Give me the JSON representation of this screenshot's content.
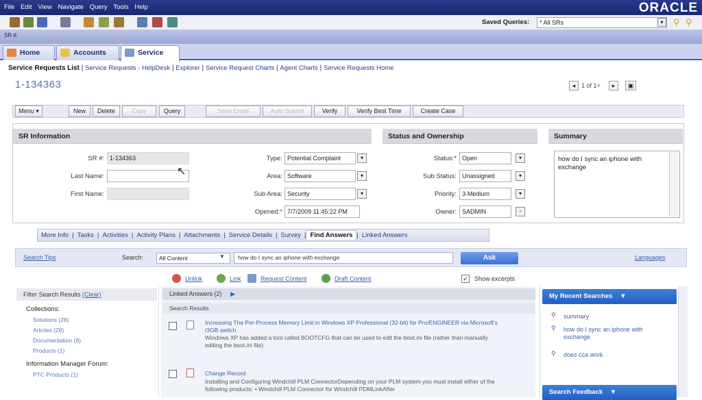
{
  "menubar": {
    "items": [
      "File",
      "Edit",
      "View",
      "Navigate",
      "Query",
      "Tools",
      "Help"
    ],
    "brand": "ORACLE"
  },
  "toolbar": {
    "saved_queries_label": "Saved Queries:",
    "saved_queries_value": "* All SRs"
  },
  "srbar": {
    "label": "SR #:"
  },
  "tabs": [
    "Home",
    "Accounts",
    "Service"
  ],
  "subnav": {
    "active": "Service Requests List",
    "items": [
      "Service Requests - HelpDesk",
      "Explorer",
      "Service Request Charts",
      "Agent Charts",
      "Service Requests Home"
    ]
  },
  "record": {
    "id": "1-134363",
    "pager": "1 of 1+"
  },
  "buttons": {
    "menu": "Menu ▾",
    "new": "New",
    "delete": "Delete",
    "copy": "Copy",
    "query": "Query",
    "send_correspondence": "Send Email",
    "auto_submit": "Auto Submit",
    "verify": "Verify",
    "verify_best_time": "Verify Best Time",
    "create_case": "Create Case"
  },
  "sr_info": {
    "header": "SR Information",
    "sr_label": "SR #:",
    "sr_value": "1-134363",
    "last_name_label": "Last Name:",
    "first_name_label": "First Name:",
    "type_label": "Type:",
    "type_value": "Potential Complaint",
    "area_label": "Area:",
    "area_value": "Software",
    "sub_area_label": "Sub Area:",
    "sub_area_value": "Security",
    "opened_label": "Opened:",
    "opened_value": "7/7/2009 11:45:22 PM"
  },
  "status": {
    "header": "Status and Ownership",
    "status_label": "Status:",
    "status_value": "Open",
    "sub_status_label": "Sub Status:",
    "sub_status_value": "Unassigned",
    "priority_label": "Priority:",
    "priority_value": "3-Medium",
    "owner_label": "Owner:",
    "owner_value": "SADMIN"
  },
  "summary": {
    "header": "Summary",
    "text": "how do I sync an iphone with exchange"
  },
  "view_tabs": {
    "items": [
      "More Info",
      "Tasks",
      "Activities",
      "Activity Plans",
      "Attachments",
      "Service Details",
      "Survey"
    ],
    "active": "Find Answers",
    "after": "Linked Answers"
  },
  "find_answers": {
    "search_tips": "Search Tips",
    "search_label": "Search:",
    "content_select": "All Content",
    "query": "how do I sync an iphone with exchange",
    "ask": "Ask",
    "languages": "Languages",
    "actions": [
      "Unlink",
      "Link",
      "Request Content",
      "Draft Content"
    ],
    "show_excerpts": "Show excerpts"
  },
  "filter": {
    "header": "Filter Search Results",
    "clear": "(Clear)",
    "collections_label": "Collections:",
    "collections": [
      "Solutions (28)",
      "Articles (28)",
      "Documentation (8)",
      "Products (1)"
    ],
    "forum_label": "Information Manager Forum:",
    "forum_items": [
      "PTC Products (1)"
    ]
  },
  "results": {
    "linked_answers": "Linked Answers (2)",
    "search_results_label": "Search Results",
    "items": [
      {
        "title": "Increasing The Per-Process Memory Limit in Windows XP Professional (32-bit) for Pro/ENGINEER via Microsoft's /3GB switch",
        "excerpt": "Windows XP has added a tool called BOOTCFG that can be used to edit the boot.ini file (rather than manually editing the boot.ini file)"
      },
      {
        "title": "Change Record",
        "excerpt": "Installing and Configuring Windchill PLM ConnectorDepending on your PLM system you must install either of the following products: • Windchill PLM Connector for Windchill PDMLinkAfter"
      }
    ]
  },
  "recent": {
    "header": "My Recent Searches",
    "items": [
      "summary",
      "how do I sync an iphone with exchange",
      "does cca work"
    ]
  },
  "feedback": {
    "header": "Search Feedback"
  },
  "colors": {
    "menubar": "#1a2770",
    "accent": "#3d6fd2",
    "link": "#3a5fa8"
  }
}
